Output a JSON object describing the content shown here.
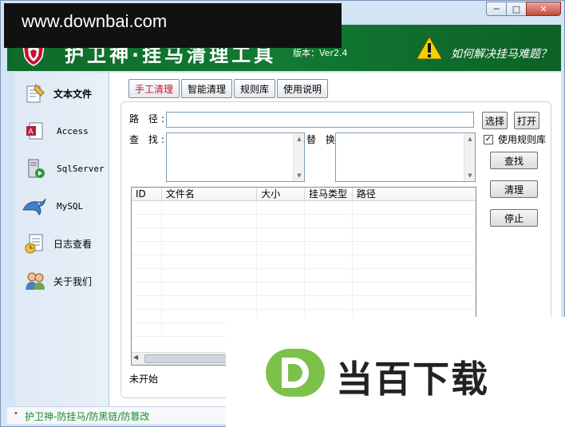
{
  "watermark_top": "www.downbai.com",
  "watermark_bottom": "当百下载",
  "window": {
    "minimize": "─",
    "maximize": "□",
    "close": "✕"
  },
  "banner": {
    "title": "护卫神·挂马清理工具",
    "version": "版本：Ver2.4",
    "help": "如何解决挂马难题？",
    "colors": {
      "green": "#127a32",
      "warn_yellow": "#f4d000"
    }
  },
  "sidebar": {
    "items": [
      {
        "label": "文本文件",
        "icon": "text-file-icon"
      },
      {
        "label": "Access",
        "icon": "access-icon"
      },
      {
        "label": "SqlServer",
        "icon": "sqlserver-icon"
      },
      {
        "label": "MySQL",
        "icon": "mysql-dolphin-icon"
      },
      {
        "label": "日志查看",
        "icon": "log-view-icon"
      },
      {
        "label": "关于我们",
        "icon": "about-us-icon"
      }
    ]
  },
  "tabs": [
    {
      "label": "手工清理",
      "active": true
    },
    {
      "label": "智能清理",
      "active": false
    },
    {
      "label": "规则库",
      "active": false
    },
    {
      "label": "使用说明",
      "active": false
    }
  ],
  "form": {
    "path_label": "路 径:",
    "path_value": "",
    "find_label": "查 找:",
    "find_value": "",
    "replace_label": "替 换:",
    "replace_value": "",
    "select_button": "选择",
    "open_button": "打开",
    "use_rules_label": "使用规则库",
    "use_rules_checked": true,
    "search_button": "查找",
    "clean_button": "清理",
    "stop_button": "停止"
  },
  "table": {
    "columns": [
      "ID",
      "文件名",
      "大小",
      "挂马类型",
      "路径"
    ],
    "rows": []
  },
  "status": "未开始",
  "bottom_bar": "护卫神-防挂马/防黑链/防篡改"
}
